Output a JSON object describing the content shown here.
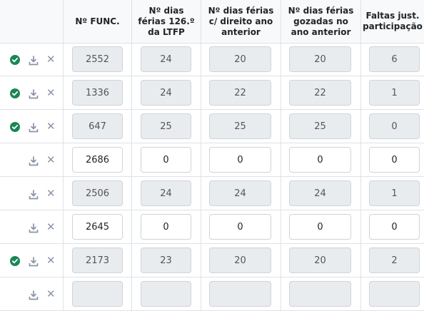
{
  "headers": [
    "Nº FUNC.",
    "Nº dias\nférias 126.º\nda LTFP",
    "Nº dias férias\nc/ direito ano\nanterior",
    "Nº dias férias\ngozadas no\nano anterior",
    "Faltas just.\nparticipação"
  ],
  "colors": {
    "check": "#198754",
    "readonly_bg": "#e9ecef",
    "border": "#dee2e6"
  },
  "icons": {
    "status": "check-circle-icon",
    "download": "download-icon",
    "remove": "close-icon"
  },
  "rows": [
    {
      "done": true,
      "readonly": true,
      "func": "2552",
      "ferias126": "24",
      "direito": "20",
      "gozadas": "20",
      "faltas": "6"
    },
    {
      "done": true,
      "readonly": true,
      "func": "1336",
      "ferias126": "24",
      "direito": "22",
      "gozadas": "22",
      "faltas": "1"
    },
    {
      "done": true,
      "readonly": true,
      "func": "647",
      "ferias126": "25",
      "direito": "25",
      "gozadas": "25",
      "faltas": "0"
    },
    {
      "done": false,
      "readonly": false,
      "func": "2686",
      "ferias126": "0",
      "direito": "0",
      "gozadas": "0",
      "faltas": "0"
    },
    {
      "done": false,
      "readonly": true,
      "func": "2506",
      "ferias126": "24",
      "direito": "24",
      "gozadas": "24",
      "faltas": "1"
    },
    {
      "done": false,
      "readonly": false,
      "func": "2645",
      "ferias126": "0",
      "direito": "0",
      "gozadas": "0",
      "faltas": "0"
    },
    {
      "done": true,
      "readonly": true,
      "func": "2173",
      "ferias126": "23",
      "direito": "20",
      "gozadas": "20",
      "faltas": "2"
    },
    {
      "done": false,
      "readonly": true,
      "func": "",
      "ferias126": "",
      "direito": "",
      "gozadas": "",
      "faltas": ""
    }
  ]
}
